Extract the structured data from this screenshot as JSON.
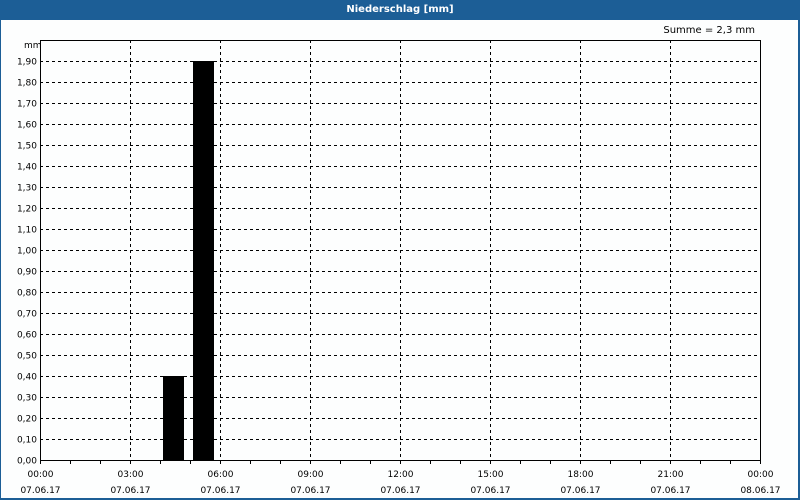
{
  "window": {
    "title": "Niederschlag [mm]"
  },
  "summary": "Summe = 2,3 mm",
  "chart_data": {
    "type": "bar",
    "title": "Niederschlag [mm]",
    "ylabel": "mm",
    "xlabel": "",
    "ylim": [
      0,
      2.0
    ],
    "xlim_hours": [
      0,
      24
    ],
    "yticks": [
      "0,00",
      "0,10",
      "0,20",
      "0,30",
      "0,40",
      "0,50",
      "0,60",
      "0,70",
      "0,80",
      "0,90",
      "1,00",
      "1,10",
      "1,20",
      "1,30",
      "1,40",
      "1,50",
      "1,60",
      "1,70",
      "1,80",
      "1,90"
    ],
    "xticks": [
      {
        "hour": 0,
        "time": "00:00",
        "date": "07.06.17"
      },
      {
        "hour": 3,
        "time": "03:00",
        "date": "07.06.17"
      },
      {
        "hour": 6,
        "time": "06:00",
        "date": "07.06.17"
      },
      {
        "hour": 9,
        "time": "09:00",
        "date": "07.06.17"
      },
      {
        "hour": 12,
        "time": "12:00",
        "date": "07.06.17"
      },
      {
        "hour": 15,
        "time": "15:00",
        "date": "07.06.17"
      },
      {
        "hour": 18,
        "time": "18:00",
        "date": "07.06.17"
      },
      {
        "hour": 21,
        "time": "21:00",
        "date": "07.06.17"
      },
      {
        "hour": 24,
        "time": "00:00",
        "date": "08.06.17"
      }
    ],
    "bars": [
      {
        "start_hour": 4,
        "end_hour": 5,
        "value": 0.4
      },
      {
        "start_hour": 5,
        "end_hour": 6,
        "value": 1.9
      }
    ],
    "grid": true,
    "bar_color": "#000000"
  }
}
